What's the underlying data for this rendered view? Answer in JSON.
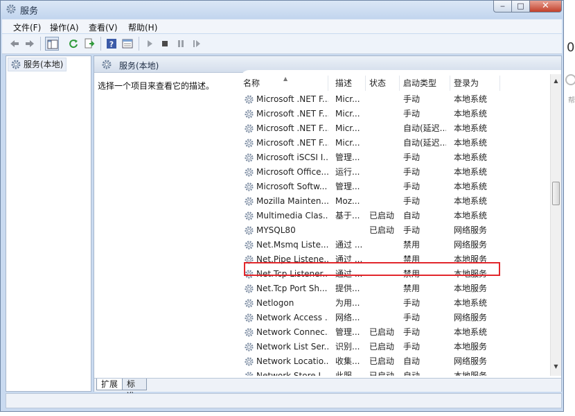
{
  "window": {
    "title": "服务",
    "caption_buttons": [
      "minimize",
      "maximize",
      "close"
    ]
  },
  "menu": [
    "文件(F)",
    "操作(A)",
    "查看(V)",
    "帮助(H)"
  ],
  "toolbar": [
    "back-icon",
    "forward-icon",
    "show-hide-tree-icon",
    "refresh-icon",
    "export-list-icon",
    "help-icon",
    "properties-icon",
    "start-icon",
    "stop-icon",
    "pause-icon",
    "restart-icon"
  ],
  "tree": {
    "item": "服务(本地)"
  },
  "panel": {
    "header": "服务(本地)",
    "description": "选择一个项目来查看它的描述。",
    "columns": [
      "名称",
      "描述",
      "状态",
      "启动类型",
      "登录为"
    ],
    "rows": [
      {
        "name": "Microsoft .NET F...",
        "desc": "Micr...",
        "status": "",
        "startup": "手动",
        "logon": "本地系统"
      },
      {
        "name": "Microsoft .NET F...",
        "desc": "Micr...",
        "status": "",
        "startup": "手动",
        "logon": "本地系统"
      },
      {
        "name": "Microsoft .NET F...",
        "desc": "Micr...",
        "status": "",
        "startup": "自动(延迟...",
        "logon": "本地系统"
      },
      {
        "name": "Microsoft .NET F...",
        "desc": "Micr...",
        "status": "",
        "startup": "自动(延迟...",
        "logon": "本地系统"
      },
      {
        "name": "Microsoft iSCSI I...",
        "desc": "管理...",
        "status": "",
        "startup": "手动",
        "logon": "本地系统"
      },
      {
        "name": "Microsoft Office...",
        "desc": "运行...",
        "status": "",
        "startup": "手动",
        "logon": "本地系统"
      },
      {
        "name": "Microsoft Softw...",
        "desc": "管理...",
        "status": "",
        "startup": "手动",
        "logon": "本地系统"
      },
      {
        "name": "Mozilla Mainten...",
        "desc": "Moz...",
        "status": "",
        "startup": "手动",
        "logon": "本地系统"
      },
      {
        "name": "Multimedia Clas...",
        "desc": "基于...",
        "status": "已启动",
        "startup": "自动",
        "logon": "本地系统"
      },
      {
        "name": "MYSQL80",
        "desc": "",
        "status": "已启动",
        "startup": "手动",
        "logon": "网络服务"
      },
      {
        "name": "Net.Msmq Liste...",
        "desc": "通过 ...",
        "status": "",
        "startup": "禁用",
        "logon": "网络服务"
      },
      {
        "name": "Net.Pipe Listene...",
        "desc": "通过 ...",
        "status": "",
        "startup": "禁用",
        "logon": "本地服务"
      },
      {
        "name": "Net.Tcp Listener...",
        "desc": "通过 ...",
        "status": "",
        "startup": "禁用",
        "logon": "本地服务"
      },
      {
        "name": "Net.Tcp Port Sh...",
        "desc": "提供...",
        "status": "",
        "startup": "禁用",
        "logon": "本地服务"
      },
      {
        "name": "Netlogon",
        "desc": "为用...",
        "status": "",
        "startup": "手动",
        "logon": "本地系统"
      },
      {
        "name": "Network Access ...",
        "desc": "网络...",
        "status": "",
        "startup": "手动",
        "logon": "网络服务"
      },
      {
        "name": "Network Connec...",
        "desc": "管理...",
        "status": "已启动",
        "startup": "手动",
        "logon": "本地系统"
      },
      {
        "name": "Network List Ser...",
        "desc": "识别...",
        "status": "已启动",
        "startup": "手动",
        "logon": "本地服务"
      },
      {
        "name": "Network Locatio...",
        "desc": "收集...",
        "status": "已启动",
        "startup": "自动",
        "logon": "网络服务"
      },
      {
        "name": "Network Store I...",
        "desc": "此服...",
        "status": "已启动",
        "startup": "自动",
        "logon": "本地服务"
      }
    ],
    "highlighted_row": "MYSQL80",
    "tabs": [
      "扩展",
      "标准"
    ]
  },
  "edge_fragments": {
    "right_digit": "0",
    "right_char": "帮"
  }
}
